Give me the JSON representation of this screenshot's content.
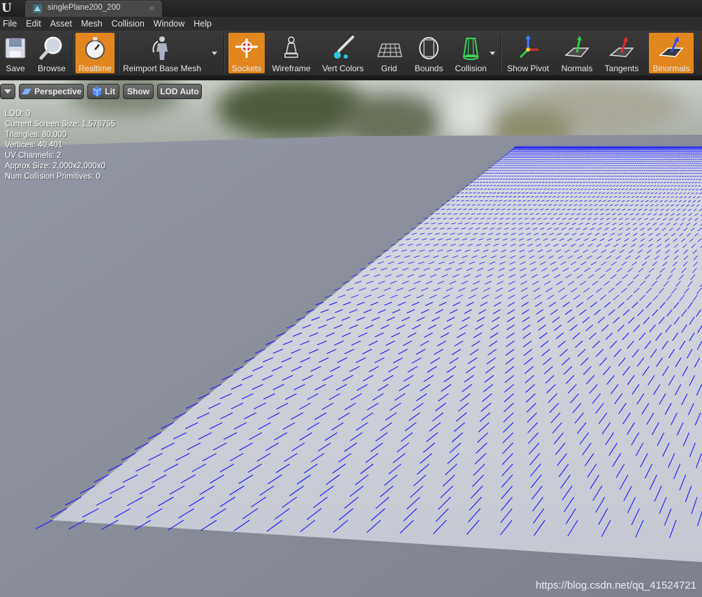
{
  "tab": {
    "title": "singlePlane200_200",
    "close_glyph": "×",
    "icon": "static-mesh-icon"
  },
  "menu": [
    "File",
    "Edit",
    "Asset",
    "Mesh",
    "Collision",
    "Window",
    "Help"
  ],
  "toolbar": {
    "save": "Save",
    "browse": "Browse",
    "realtime": "Realtime",
    "reimport": "Reimport Base Mesh",
    "sockets": "Sockets",
    "wireframe": "Wireframe",
    "vert_colors": "Vert Colors",
    "grid": "Grid",
    "bounds": "Bounds",
    "collision": "Collision",
    "show_pivot": "Show Pivot",
    "normals": "Normals",
    "tangents": "Tangents",
    "binormals": "Binormals",
    "active_color": "#e2861e"
  },
  "viewport_toolbar": {
    "perspective": "Perspective",
    "lit": "Lit",
    "show": "Show",
    "lod": "LOD Auto"
  },
  "stats": [
    "LOD:  0",
    "Current Screen Size:  1.576755",
    "Triangles:  80,000",
    "Vertices:  40,401",
    "UV Channels:  2",
    "Approx Size: 2,000x2,000x0",
    "Num Collision Primitives:  0"
  ],
  "watermark": "https://blog.csdn.net/qq_41524721",
  "colors": {
    "binormal_lines": "#1a1aff",
    "plane": "#c9ccd6",
    "ground": "#878b98"
  }
}
